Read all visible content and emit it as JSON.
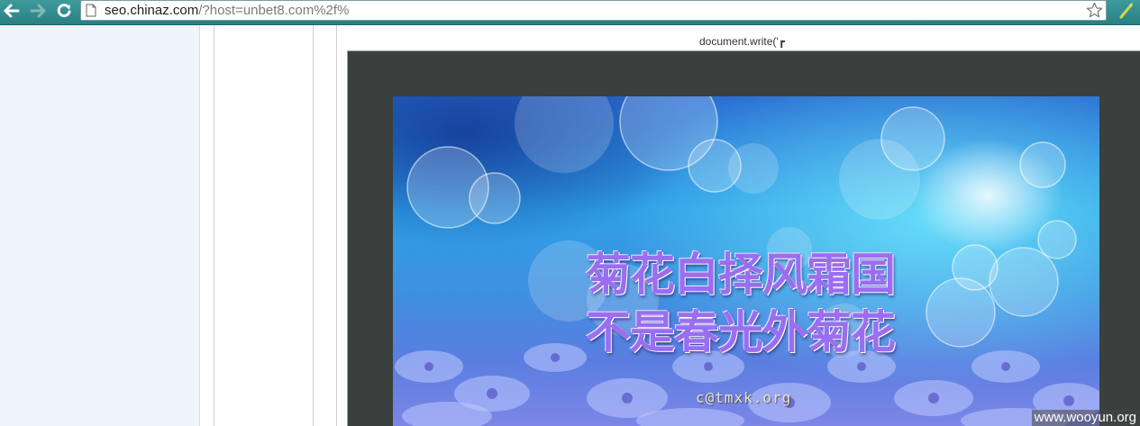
{
  "browser": {
    "url_host": "seo.chinaz.com",
    "url_path": "/?host=unbet8.com%2f%"
  },
  "page": {
    "doc_write_text": "document.write('┏",
    "banner": {
      "line1": "菊花白择风霜国",
      "line2": "不是春光外菊花",
      "credit": "c@tmxk.org"
    }
  },
  "watermark": "www.wooyun.org",
  "colors": {
    "toolbar": "#2a7f84",
    "frame": "#3a403d",
    "poem_text": "#9a6ef0",
    "left_pane": "#eef5fc"
  }
}
